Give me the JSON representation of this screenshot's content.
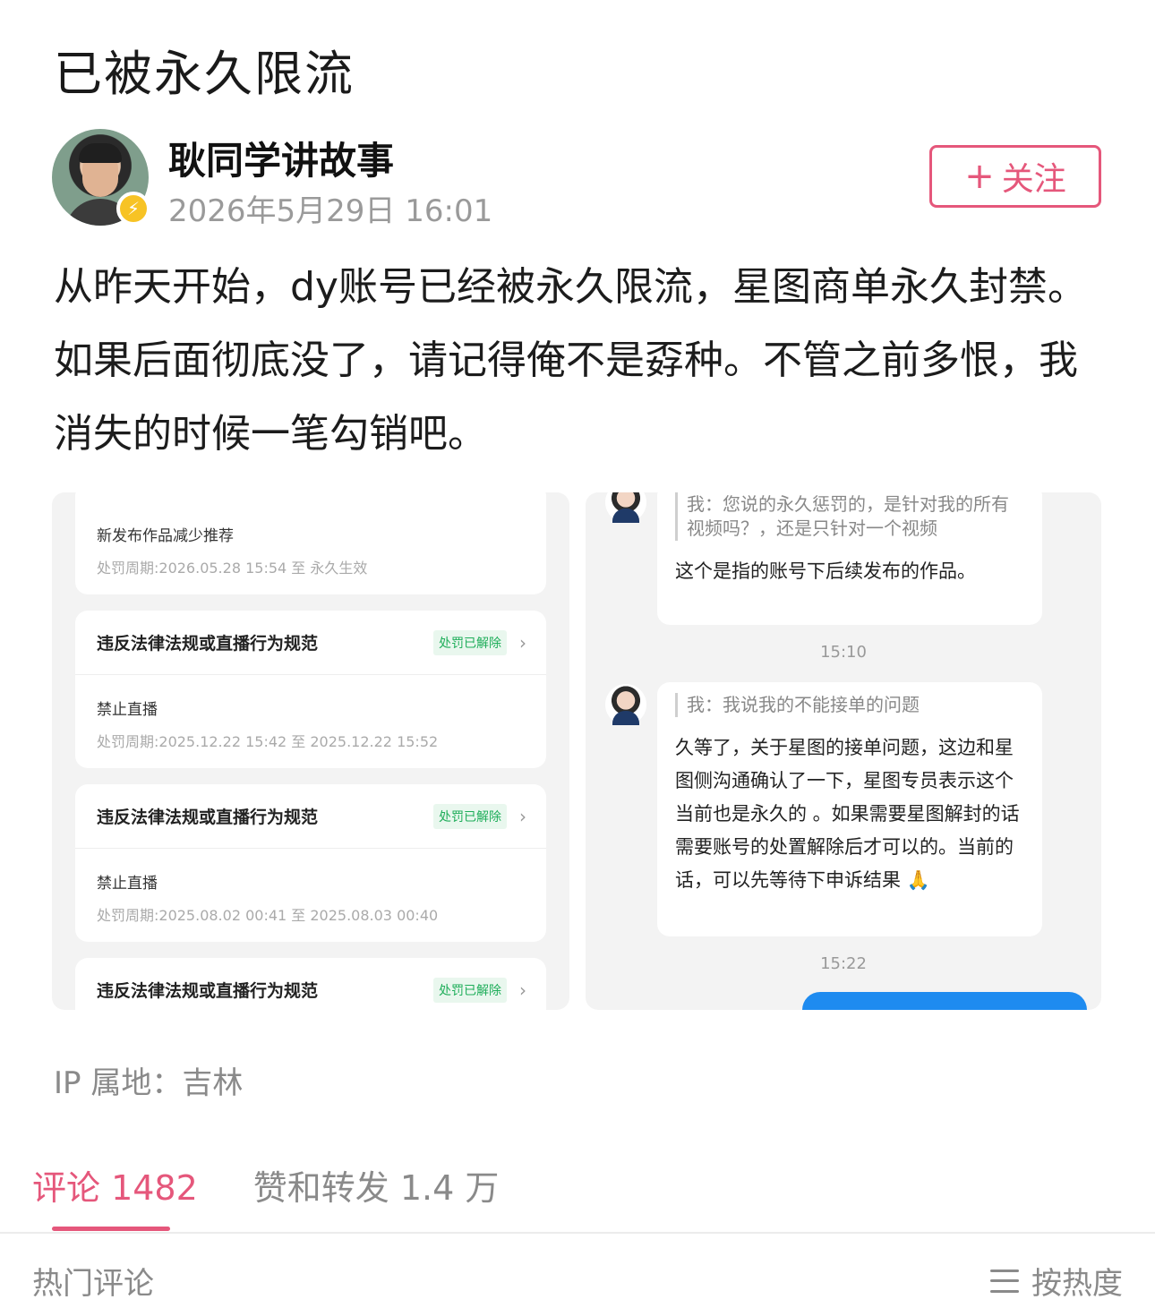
{
  "post": {
    "title": "已被永久限流",
    "author": "耿同学讲故事",
    "time": "2026年5月29日 16:01",
    "follow_label": "关注",
    "body": "从昨天开始，dy账号已经被永久限流，星图商单永久封禁。如果后面彻底没了，请记得俺不是孬种。不管之前多恨，我消失的时候一笔勾销吧。",
    "ip": "IP 属地：吉林"
  },
  "left_image": {
    "cards": [
      {
        "title": "",
        "badge": "",
        "line1": "新发布作品减少推荐",
        "line2": "处罚周期:2026.05.28 15:54 至 永久生效"
      },
      {
        "title": "违反法律法规或直播行为规范",
        "badge": "处罚已解除",
        "line1": "禁止直播",
        "line2": "处罚周期:2025.12.22 15:42 至 2025.12.22 15:52"
      },
      {
        "title": "违反法律法规或直播行为规范",
        "badge": "处罚已解除",
        "line1": "禁止直播",
        "line2": "处罚周期:2025.08.02 00:41 至 2025.08.03 00:40"
      },
      {
        "title": "违反法律法规或直播行为规范",
        "badge": "处罚已解除",
        "line1": "",
        "line2": ""
      }
    ]
  },
  "right_image": {
    "messages": [
      {
        "quote": "我：您说的永久惩罚的，是针对我的所有视频吗？，还是只针对一个视频",
        "reply": "这个是指的账号下后续发布的作品。"
      },
      {
        "quote": "我：我说我的不能接单的问题",
        "reply": "久等了，关于星图的接单问题，这边和星图侧沟通确认了一下，星图专员表示这个当前也是永久的 。如果需要星图解封的话 需要账号的处置解除后才可以的。当前的话，可以先等待下申诉结果 🙏"
      }
    ],
    "stamps": [
      "15:10",
      "15:22"
    ]
  },
  "tabs": {
    "comments": "评论 1482",
    "likes": "赞和转发 1.4 万"
  },
  "footer": {
    "hot": "热门评论",
    "sort": "按热度"
  },
  "colors": {
    "accent": "#e5577b",
    "badge_green": "#1fae5a",
    "blue": "#1e8bf0"
  }
}
